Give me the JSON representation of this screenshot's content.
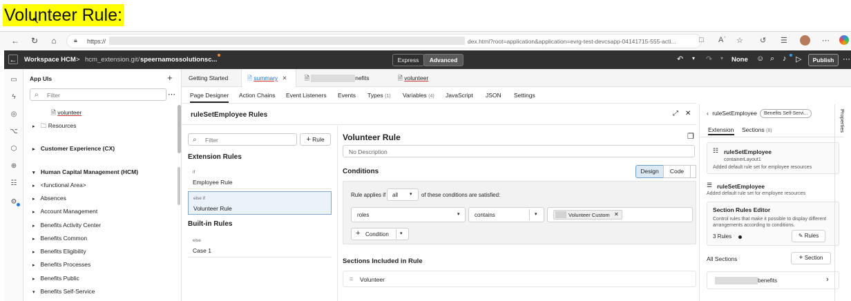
{
  "heading": "Volunteer Rule:",
  "browser": {
    "url_prefix": "https://",
    "url_suffix": "dex.html?root=application&application=evrg-test-devcsapp-04141715-555-acti..."
  },
  "app_header": {
    "workspace": "Workspace HCM",
    "separator": ">",
    "repo": "hcm_extension.git/",
    "branch": "speernamossolutionsc...",
    "mode_express": "Express",
    "mode_advanced": "Advanced",
    "none_label": "None",
    "publish": "Publish"
  },
  "tree": {
    "title": "App UIs",
    "filter_placeholder": "Filter",
    "items": [
      {
        "label": "volunteer"
      },
      {
        "label": "Resources"
      },
      {
        "label": "Customer Experience (CX)"
      },
      {
        "label": "Human Capital Management (HCM)"
      },
      {
        "label": "<functional Area>"
      },
      {
        "label": "Absences"
      },
      {
        "label": "Account Management"
      },
      {
        "label": "Benefits Activity Center"
      },
      {
        "label": "Benefits Common"
      },
      {
        "label": "Benefits Eligibility"
      },
      {
        "label": "Benefits Processes"
      },
      {
        "label": "Benefits Public"
      },
      {
        "label": "Benefits Self-Service"
      }
    ]
  },
  "file_tabs": {
    "getting_started": "Getting Started",
    "summary": "summary",
    "benefits_suffix": "nefits",
    "volunteer": "volunteer"
  },
  "sub_tabs": [
    {
      "label": "Page Designer",
      "count": ""
    },
    {
      "label": "Action Chains",
      "count": ""
    },
    {
      "label": "Event Listeners",
      "count": ""
    },
    {
      "label": "Events",
      "count": ""
    },
    {
      "label": "Types",
      "count": "(1)"
    },
    {
      "label": "Variables",
      "count": "(4)"
    },
    {
      "label": "JavaScript",
      "count": ""
    },
    {
      "label": "JSON",
      "count": ""
    },
    {
      "label": "Settings",
      "count": ""
    }
  ],
  "rules_panel": {
    "title": "ruleSetEmployee Rules",
    "filter_placeholder": "Filter",
    "add_rule": "Rule",
    "extension_rules_title": "Extension Rules",
    "extension_rules": [
      {
        "kind": "if",
        "name": "Employee Rule"
      },
      {
        "kind": "else if",
        "name": "Volunteer Rule"
      }
    ],
    "builtin_rules_title": "Built-in Rules",
    "builtin_rules": [
      {
        "kind": "else",
        "name": "Case 1"
      }
    ]
  },
  "rule_detail": {
    "title": "Volunteer Rule",
    "description_placeholder": "No Description",
    "conditions_title": "Conditions",
    "design_label": "Design",
    "code_label": "Code",
    "applies_prefix": "Rule applies if",
    "applies_value": "all",
    "applies_suffix": "of these conditions are satisfied:",
    "condition_field": "roles",
    "condition_operator": "contains",
    "condition_value": "Volunteer Custom",
    "add_condition": "Condition",
    "sections_title": "Sections Included in Rule",
    "sections": [
      "Volunteer"
    ]
  },
  "properties": {
    "vertical_label": "Properties",
    "back_title": "ruleSetEmployee",
    "badge": "Benefits Self-Servi...",
    "tab_extension": "Extension",
    "tab_sections": "Sections",
    "tab_sections_count": "(8)",
    "card1_title": "ruleSetEmployee",
    "card1_sub": "containerLayout1",
    "card1_desc": "Added default rule set for employee resources",
    "card2_title": "ruleSetEmployee",
    "card2_desc": "Added default rule set for employee resources",
    "editor_title": "Section Rules Editor",
    "editor_desc": "Control rules that make it possible to display different arrangements according to conditions.",
    "rules_count": "3 Rules",
    "rules_button": "Rules",
    "all_sections": "All Sections",
    "section_button": "Section",
    "section_item_suffix": "benefits"
  }
}
